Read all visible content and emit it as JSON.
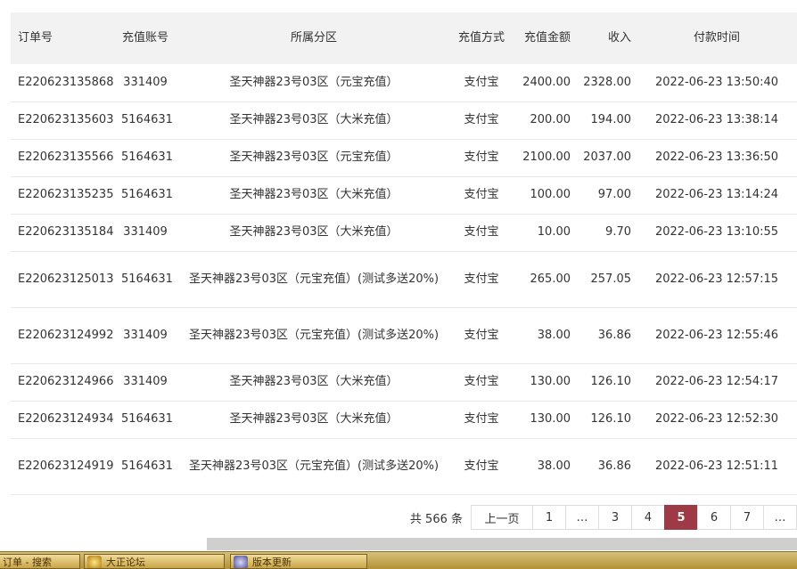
{
  "colors": {
    "header_bg": "#f2f2f2",
    "active_page": "#9e3a45",
    "taskbar": "#c9a448",
    "top_mark": "#d9363e"
  },
  "table": {
    "headers": {
      "order": "订单号",
      "account": "充值账号",
      "zone": "所属分区",
      "method": "充值方式",
      "amount": "充值金额",
      "income": "收入",
      "time": "付款时间"
    },
    "rows": [
      {
        "order": "E220623135868",
        "account": "331409",
        "zone": "圣天神器23号03区（元宝充值）",
        "method": "支付宝",
        "amount": "2400.00",
        "income": "2328.00",
        "time": "2022-06-23 13:50:40"
      },
      {
        "order": "E220623135603",
        "account": "5164631",
        "zone": "圣天神器23号03区（大米充值）",
        "method": "支付宝",
        "amount": "200.00",
        "income": "194.00",
        "time": "2022-06-23 13:38:14"
      },
      {
        "order": "E220623135566",
        "account": "5164631",
        "zone": "圣天神器23号03区（元宝充值）",
        "method": "支付宝",
        "amount": "2100.00",
        "income": "2037.00",
        "time": "2022-06-23 13:36:50"
      },
      {
        "order": "E220623135235",
        "account": "5164631",
        "zone": "圣天神器23号03区（大米充值）",
        "method": "支付宝",
        "amount": "100.00",
        "income": "97.00",
        "time": "2022-06-23 13:14:24"
      },
      {
        "order": "E220623135184",
        "account": "331409",
        "zone": "圣天神器23号03区（大米充值）",
        "method": "支付宝",
        "amount": "10.00",
        "income": "9.70",
        "time": "2022-06-23 13:10:55"
      },
      {
        "order": "E220623125013",
        "account": "5164631",
        "zone": "圣天神器23号03区（元宝充值）(测试多送20%)",
        "method": "支付宝",
        "amount": "265.00",
        "income": "257.05",
        "time": "2022-06-23 12:57:15"
      },
      {
        "order": "E220623124992",
        "account": "331409",
        "zone": "圣天神器23号03区（元宝充值）(测试多送20%)",
        "method": "支付宝",
        "amount": "38.00",
        "income": "36.86",
        "time": "2022-06-23 12:55:46"
      },
      {
        "order": "E220623124966",
        "account": "331409",
        "zone": "圣天神器23号03区（大米充值）",
        "method": "支付宝",
        "amount": "130.00",
        "income": "126.10",
        "time": "2022-06-23 12:54:17"
      },
      {
        "order": "E220623124934",
        "account": "5164631",
        "zone": "圣天神器23号03区（大米充值）",
        "method": "支付宝",
        "amount": "130.00",
        "income": "126.10",
        "time": "2022-06-23 12:52:30"
      },
      {
        "order": "E220623124919",
        "account": "5164631",
        "zone": "圣天神器23号03区（元宝充值）(测试多送20%)",
        "method": "支付宝",
        "amount": "38.00",
        "income": "36.86",
        "time": "2022-06-23 12:51:11"
      }
    ]
  },
  "pagination": {
    "total_text": "共 566 条",
    "prev_label": "上一页",
    "pages": [
      "1",
      "…",
      "3",
      "4",
      "5",
      "6",
      "7",
      "…"
    ],
    "current": "5"
  },
  "taskbar": {
    "left_label": "订单 - 搜索",
    "buttons": [
      {
        "label": "大正论坛",
        "icon": "game-icon"
      },
      {
        "label": "版本更新",
        "icon": "game-icon"
      }
    ]
  }
}
